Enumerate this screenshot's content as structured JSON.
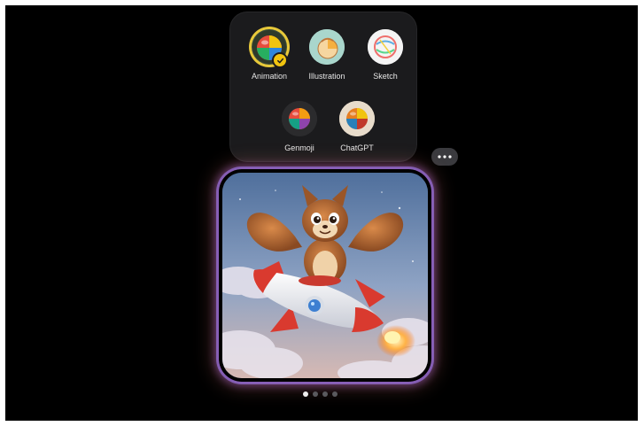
{
  "styles": [
    {
      "label": "Animation",
      "icon": "animation-style-icon",
      "selected": true
    },
    {
      "label": "Illustration",
      "icon": "illustration-style-icon",
      "selected": false
    },
    {
      "label": "Sketch",
      "icon": "sketch-style-icon",
      "selected": false
    },
    {
      "label": "Genmoji",
      "icon": "genmoji-style-icon",
      "selected": false
    },
    {
      "label": "ChatGPT",
      "icon": "chatgpt-style-icon",
      "selected": false
    }
  ],
  "more_button": {
    "icon": "ellipsis-icon"
  },
  "generated_image": {
    "subject": "squirrel-riding-rocket"
  },
  "pagination": {
    "total": 4,
    "current": 1
  },
  "colors": {
    "selected_ring": "#e8c93a",
    "panel_bg": "#1b1b1d",
    "glow_purple": "#b482ff",
    "glow_orange": "#ff8c78"
  }
}
